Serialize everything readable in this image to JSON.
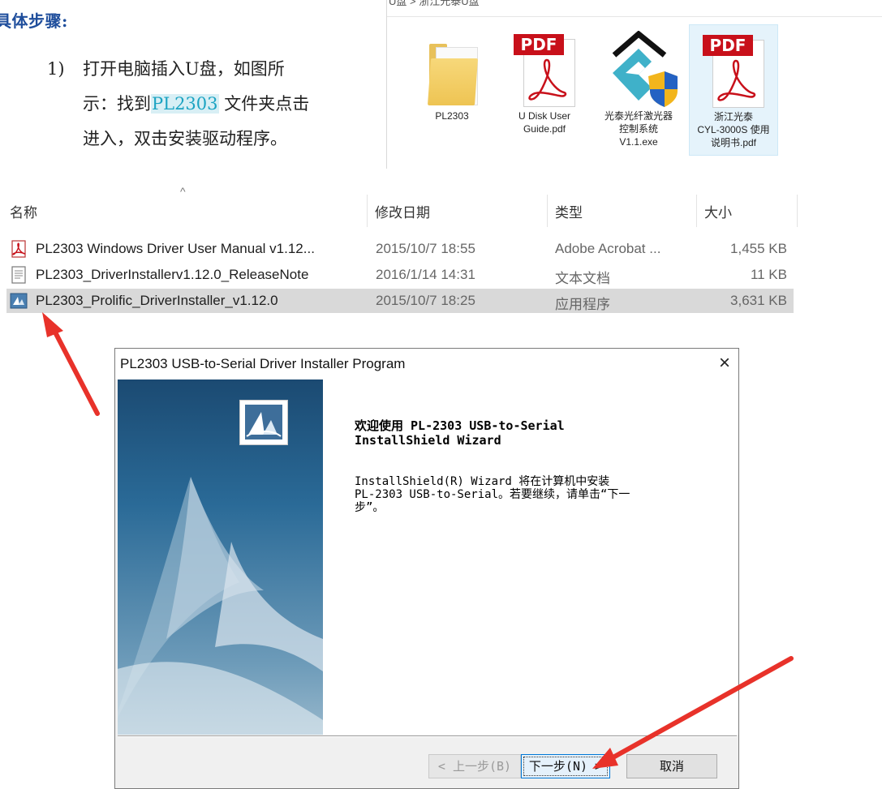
{
  "document": {
    "heading": "具体步骤:",
    "step_number": "1)",
    "step_lines": [
      "打开电脑插入U盘，如图所",
      "示：找到",
      "文件夹点击",
      "进入，双击安装驱动程序。"
    ],
    "step_highlight": "PL2303"
  },
  "folder_view": {
    "path_text": "U盘 > 浙江光泰U盘",
    "files": [
      {
        "name": "PL2303",
        "icon": "folder-icon"
      },
      {
        "name": "U Disk User\nGuide.pdf",
        "icon": "pdf-icon"
      },
      {
        "name": "光泰光纤激光器\n控制系统\nV1.1.exe",
        "icon": "app-icon"
      },
      {
        "name": "浙江光泰\nCYL-3000S 使用\n说明书.pdf",
        "icon": "pdf-icon",
        "selected": true
      }
    ]
  },
  "list_view": {
    "columns": [
      "名称",
      "修改日期",
      "类型",
      "大小"
    ],
    "rows": [
      {
        "name": "PL2303 Windows Driver User Manual v1.12...",
        "date": "2015/10/7 18:55",
        "type": "Adobe Acrobat ...",
        "size": "1,455 KB",
        "icon": "pdf-file-icon"
      },
      {
        "name": "PL2303_DriverInstallerv1.12.0_ReleaseNote",
        "date": "2016/1/14 14:31",
        "type": "文本文档",
        "size": "11 KB",
        "icon": "text-file-icon"
      },
      {
        "name": "PL2303_Prolific_DriverInstaller_v1.12.0",
        "date": "2015/10/7 18:25",
        "type": "应用程序",
        "size": "3,631 KB",
        "icon": "installer-icon",
        "selected": true
      }
    ]
  },
  "dialog": {
    "title": "PL2303 USB-to-Serial Driver Installer Program",
    "close_label": "×",
    "welcome": "欢迎使用 PL-2303 USB-to-Serial\nInstallShield Wizard",
    "description": "InstallShield(R) Wizard 将在计算机中安装\nPL-2303 USB-to-Serial。若要继续，请单击“下一\n步”。",
    "back_button": "< 上一步(B)",
    "next_button": "下一步(N) >",
    "cancel_button": "取消"
  },
  "colors": {
    "heading": "#1f4e9c",
    "highlight": "#1ba3c2",
    "arrow": "#e8322a",
    "selection": "#d9d9d9",
    "focus": "#0078d7"
  }
}
